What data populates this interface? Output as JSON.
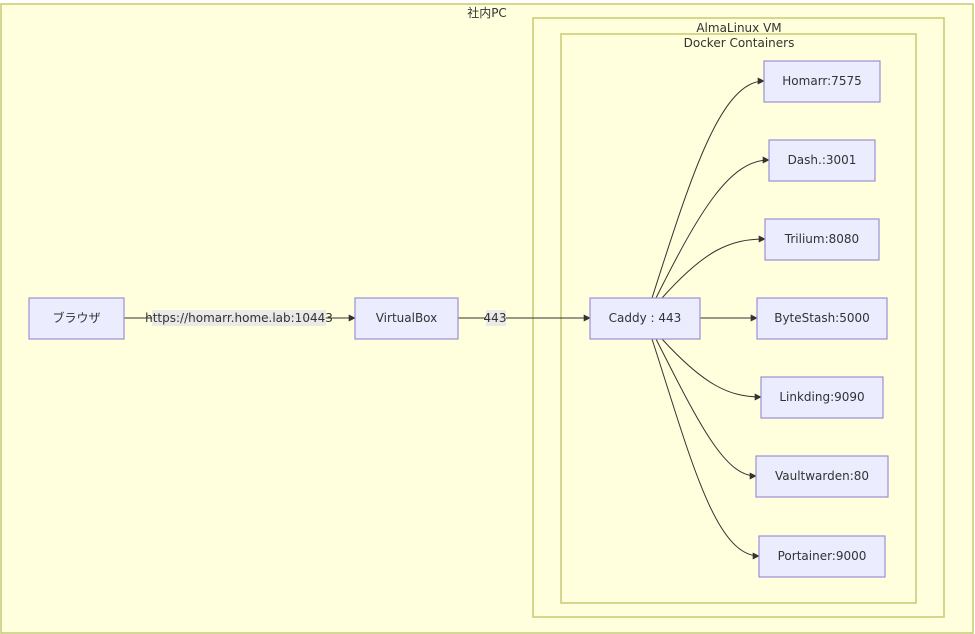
{
  "clusters": {
    "outer": "社内PC",
    "vm": "AlmaLinux VM",
    "docker": "Docker Containers"
  },
  "nodes": {
    "browser": "ブラウザ",
    "virtualbox": "VirtualBox",
    "caddy": "Caddy : 443",
    "homarr": "Homarr:7575",
    "dash": "Dash.:3001",
    "trilium": "Trilium:8080",
    "bytestash": "ByteStash:5000",
    "linkding": "Linkding:9090",
    "vaultwarden": "Vaultwarden:80",
    "portainer": "Portainer:9000"
  },
  "edges": {
    "browser_to_vbox": "https://homarr.home.lab:10443",
    "vbox_to_caddy": "443"
  }
}
